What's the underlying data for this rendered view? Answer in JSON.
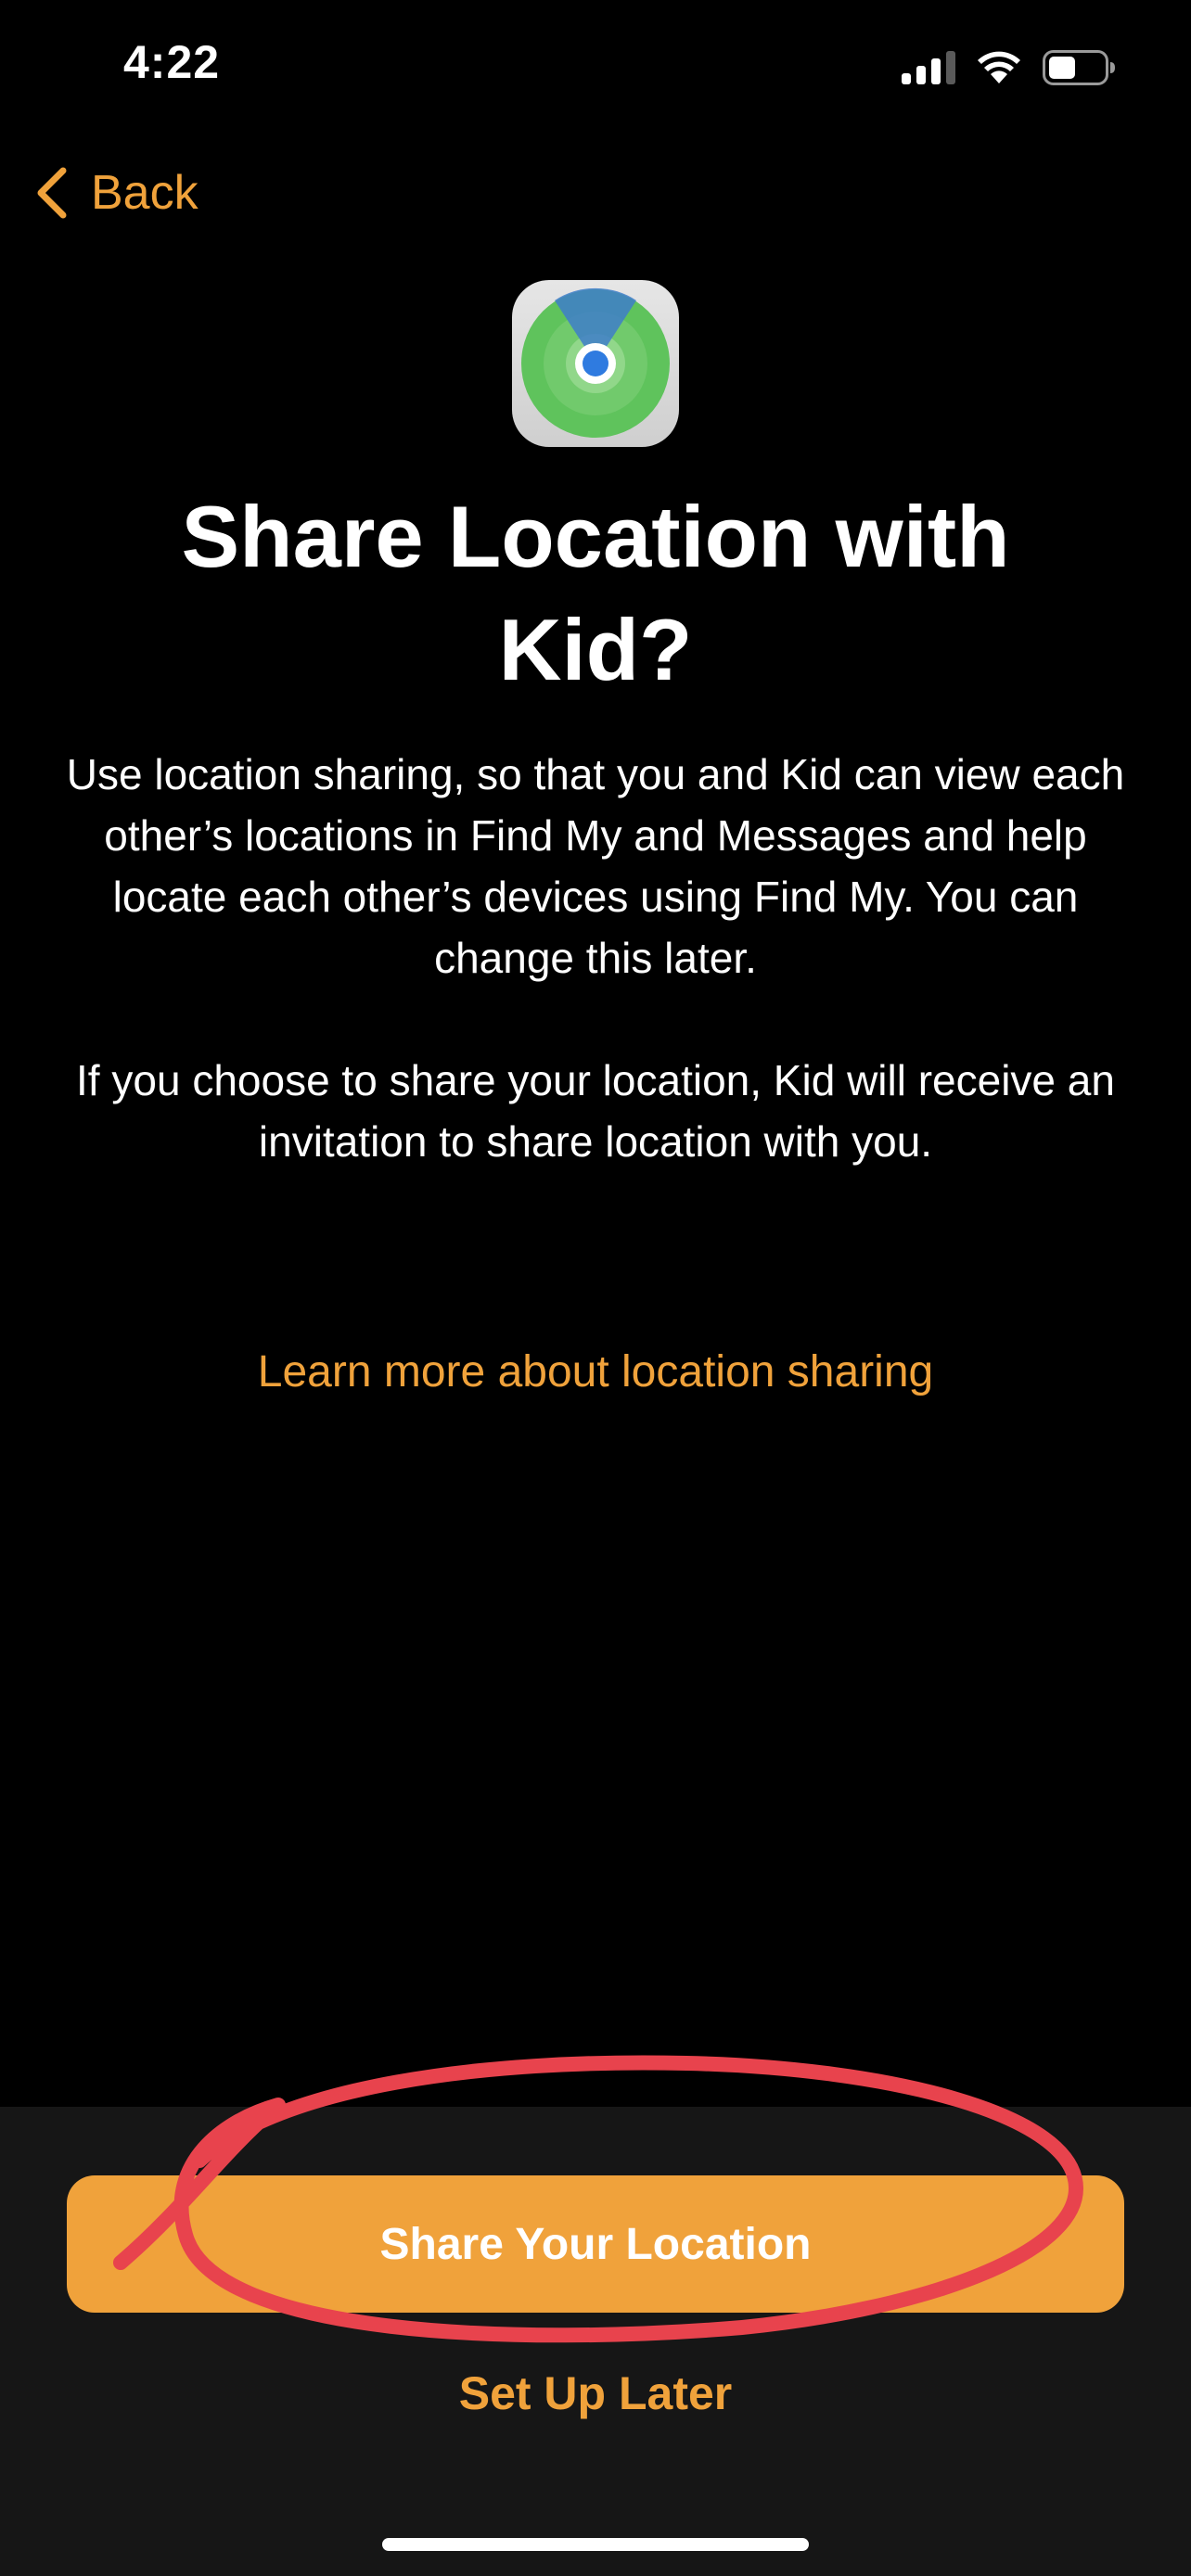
{
  "status_bar": {
    "time": "4:22",
    "icons": [
      "cellular-signal-icon",
      "wifi-icon",
      "battery-icon"
    ]
  },
  "nav": {
    "back_label": "Back",
    "back_icon": "chevron-left-icon"
  },
  "app_icon": {
    "name": "find-my-app-icon"
  },
  "title": "Share Location with Kid?",
  "body": {
    "paragraph_1": "Use location sharing, so that you and Kid can view each other’s locations in Find My and Messages and help locate each other’s devices using Find My. You can change this later.",
    "paragraph_2": "If you choose to share your location, Kid will receive an invitation to share location with you."
  },
  "link": {
    "learn_more": "Learn more about location sharing"
  },
  "actions": {
    "primary": "Share Your Location",
    "secondary": "Set Up Later"
  },
  "colors": {
    "accent": "#f0a23b",
    "background": "#000000",
    "sheet_background": "#161616",
    "annotation_red": "#e8434d"
  }
}
